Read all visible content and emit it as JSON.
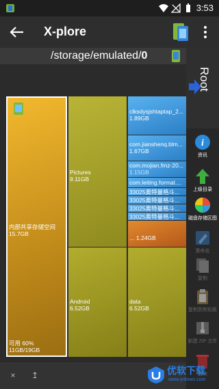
{
  "status_bar": {
    "time": "3:53"
  },
  "app_bar": {
    "title": "X-plore"
  },
  "path_bar": {
    "path_prefix": "/storage/emulated/",
    "path_bold": "0"
  },
  "side_tab": {
    "label": "Root"
  },
  "tiles": {
    "internal": {
      "name": "内部共享存储空间",
      "size": "15.7GB",
      "free": "可用 60%",
      "usage": "11GB/19GB"
    },
    "pictures": {
      "name": "Pictures",
      "size": "9.11GB"
    },
    "android": {
      "name": "Android",
      "size": "6.52GB"
    },
    "data": {
      "name": "data",
      "size": "6.52GB"
    },
    "app1": {
      "name": "clksdysjshtaptap_2...",
      "size": "1.89GB"
    },
    "app2": {
      "name": "com.jianshenq.blm...",
      "size": "1.67GB"
    },
    "app3": {
      "name": "com.mojian.fmz-20...",
      "size": "1.15GB"
    },
    "app4": {
      "name": "com.leiting.formal....",
      "size": ""
    },
    "s1": {
      "name": "33025奥特曼格斗..."
    },
    "s2": {
      "name": "33025奥特曼格斗..."
    },
    "s3": {
      "name": "33025奥特曼格斗..."
    },
    "s4": {
      "name": "33025奥特曼格斗..."
    },
    "other": {
      "name": "...",
      "size": "1.24GB"
    }
  },
  "toolbar": [
    {
      "label": "资讯",
      "icon": "info-icon"
    },
    {
      "label": "上级目录",
      "icon": "up-arrow-icon"
    },
    {
      "label": "磁盘存储区图",
      "icon": "disk-map-icon"
    },
    {
      "label": "重命名",
      "icon": "rename-icon"
    },
    {
      "label": "复制",
      "icon": "copy-icon"
    },
    {
      "label": "复制到剪贴板",
      "icon": "clipboard-icon"
    },
    {
      "label": "新建 ZIP 文件",
      "icon": "zip-icon"
    },
    {
      "label": "删除",
      "icon": "trash-icon"
    }
  ],
  "bottom_bar": {
    "close": "×",
    "pin": "↥"
  },
  "watermark": {
    "main": "优软下载",
    "sub": "www.yrdown.com"
  },
  "colors": {
    "accent": "#2a7de1",
    "internal_tile": "#d8a02a",
    "folder_tile": "#a9a324",
    "app_tile": "#3b96db",
    "other_tile": "#c96c1f"
  }
}
